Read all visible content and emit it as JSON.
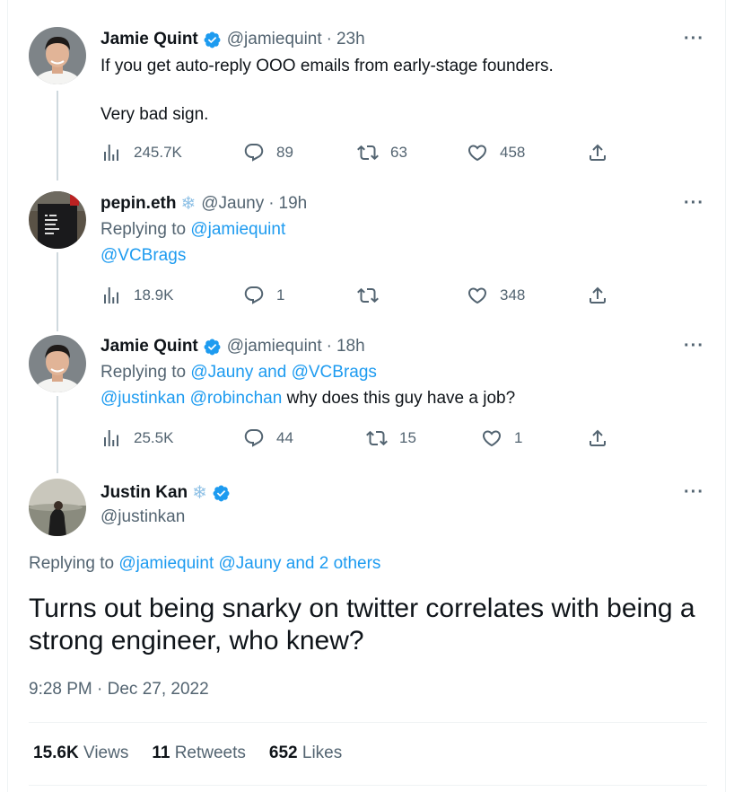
{
  "colors": {
    "accent": "#1d9bf0",
    "secondary_text": "#536471",
    "primary_text": "#0f1419",
    "thread_line": "#cfd9de"
  },
  "thread": [
    {
      "name": "Jamie Quint",
      "verified": true,
      "snowflake": false,
      "handle": "@jamiequint",
      "time": "23h",
      "text_line1": "If you get auto-reply OOO emails from early-stage founders.",
      "text_line2": "Very bad sign.",
      "views": "245.7K",
      "replies": "89",
      "retweets": "63",
      "likes": "458"
    },
    {
      "name": "pepin.eth",
      "verified": false,
      "snowflake": true,
      "handle": "@Jauny",
      "time": "19h",
      "replying_prefix": "Replying to",
      "replying_to": "@jamiequint",
      "text_line1": "@VCBrags",
      "views": "18.9K",
      "replies": "1",
      "retweets": "",
      "likes": "348"
    },
    {
      "name": "Jamie Quint",
      "verified": true,
      "snowflake": false,
      "handle": "@jamiequint",
      "time": "18h",
      "replying_prefix": "Replying to",
      "replying_to": "@Jauny and @VCBrags",
      "mention1": "@justinkan",
      "mention2": "@robinchan",
      "text_rest": "why does this guy have a job?",
      "views": "25.5K",
      "replies": "44",
      "retweets": "15",
      "likes": "1"
    }
  ],
  "main_tweet": {
    "name": "Justin Kan",
    "handle": "@justinkan",
    "replying_prefix": "Replying to",
    "replying_to": "@jamiequint @Jauny and 2 others",
    "text": "Turns out being snarky on twitter correlates with being a strong engineer, who knew?",
    "timestamp": "9:28 PM · Dec 27, 2022",
    "views_count": "15.6K",
    "views_label": "Views",
    "retweets_count": "11",
    "retweets_label": "Retweets",
    "likes_count": "652",
    "likes_label": "Likes"
  }
}
